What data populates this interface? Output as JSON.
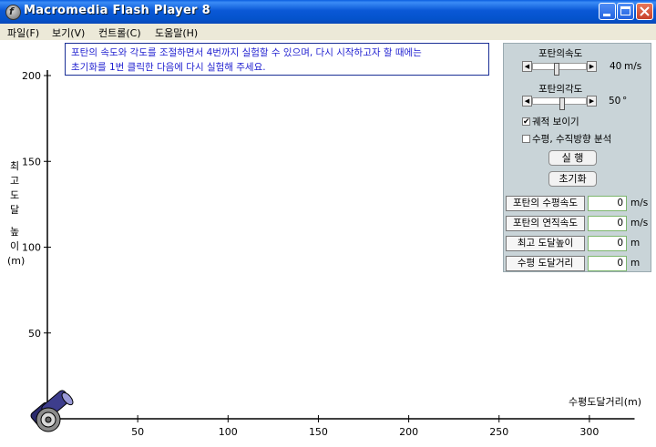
{
  "window": {
    "title": "Macromedia Flash Player 8",
    "app_icon_glyph": "f"
  },
  "menu": [
    {
      "label": "파일(F)"
    },
    {
      "label": "보기(V)"
    },
    {
      "label": "컨트롤(C)"
    },
    {
      "label": "도움말(H)"
    }
  ],
  "instructions": {
    "line1": "포탄의 속도와 각도를 조절하면서 4번까지 실험할 수 있으며, 다시 시작하고자 할 때에는",
    "line2": "초기화를  1번  클릭한 다음에 다시 실험해 주세요."
  },
  "controls": {
    "speed": {
      "label": "포탄의속도",
      "value": "40",
      "unit": "m/s",
      "fraction": 0.45
    },
    "angle": {
      "label": "포탄의각도",
      "value": "50",
      "unit": "°",
      "fraction": 0.55
    },
    "show_trajectory": {
      "label": "궤적 보이기",
      "checked": true
    },
    "analyze": {
      "label": "수평, 수직방향 분석",
      "checked": false
    },
    "run_label": "실  행",
    "reset_label": "초기화"
  },
  "readouts": [
    {
      "label": "포탄의  수평속도",
      "value": "0",
      "unit": "m/s"
    },
    {
      "label": "포탄의  연직속도",
      "value": "0",
      "unit": "m/s"
    },
    {
      "label": "최고  도달높이",
      "value": "0",
      "unit": "m"
    },
    {
      "label": "수평  도달거리",
      "value": "0",
      "unit": "m"
    }
  ],
  "chart_data": {
    "type": "scatter",
    "ylabel_chars": [
      "최",
      "고",
      "도",
      "달",
      "",
      "높",
      "이",
      "(m)"
    ],
    "xlabel": "수평도달거리(m)",
    "x_ticks": [
      50,
      100,
      150,
      200,
      250,
      300
    ],
    "y_ticks": [
      50,
      100,
      150,
      200
    ],
    "xlim": [
      0,
      325
    ],
    "ylim": [
      0,
      200
    ],
    "series": []
  }
}
